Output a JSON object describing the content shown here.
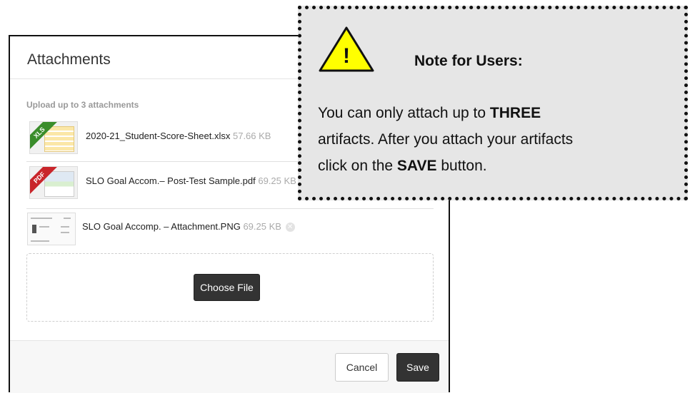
{
  "modal": {
    "title": "Attachments",
    "upload_hint": "Upload up to 3 attachments",
    "attachments": [
      {
        "name": "2020-21_Student-Score-Sheet.xlsx",
        "size": "57.66 KB",
        "type_badge": "XLS"
      },
      {
        "name": "SLO Goal Accom.– Post-Test Sample.pdf",
        "size": "69.25 KB",
        "type_badge": "PDF"
      },
      {
        "name": "SLO Goal Accomp. – Attachment.PNG",
        "size": "69.25 KB"
      }
    ],
    "choose_file_label": "Choose File",
    "cancel_label": "Cancel",
    "save_label": "Save"
  },
  "note": {
    "icon": "warning-icon",
    "icon_glyph": "!",
    "title": "Note for Users:",
    "line1_a": "You can only attach up to ",
    "line1_bold": "THREE",
    "line2": "artifacts. After you attach your artifacts",
    "line3_a": "click on the ",
    "line3_bold": "SAVE",
    "line3_b": " button."
  },
  "colors": {
    "dark_button": "#333333",
    "warning_fill": "#ffff00",
    "note_background": "#e6e6e6",
    "muted_text": "#999999"
  }
}
